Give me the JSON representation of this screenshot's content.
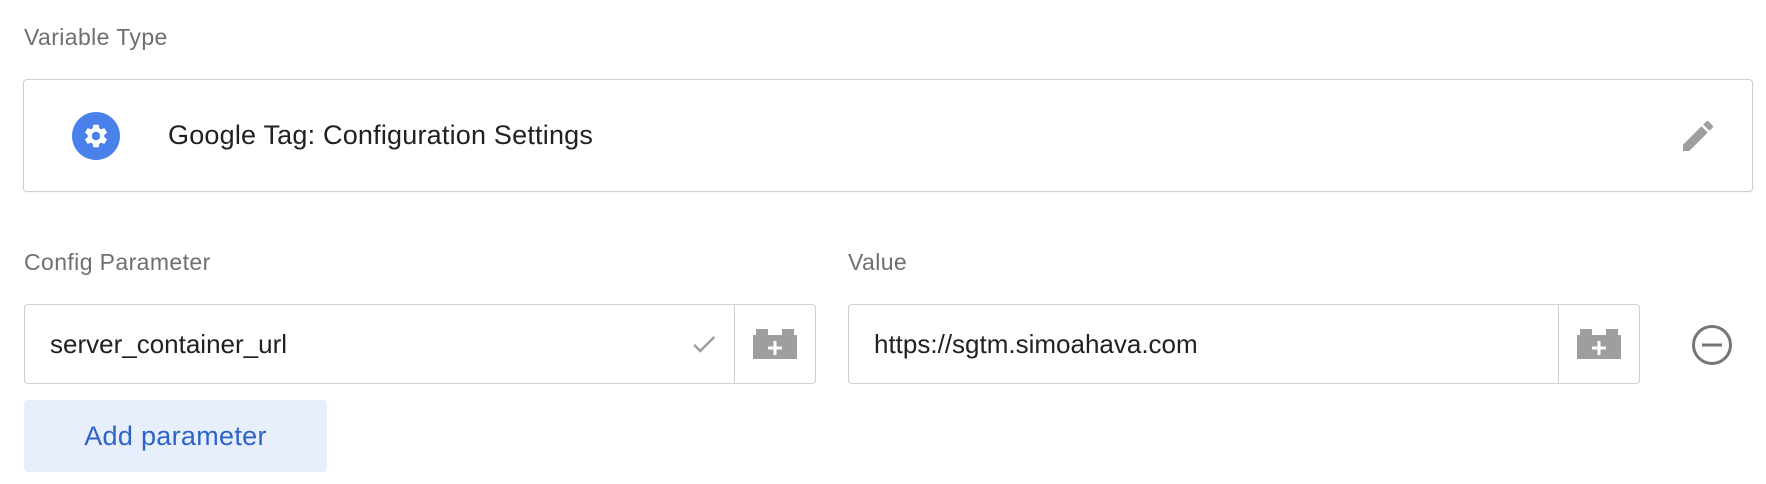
{
  "variable_type": {
    "section_label": "Variable Type",
    "title": "Google Tag: Configuration Settings",
    "icon": "gear-icon",
    "icon_color": "#4a80ea",
    "edit_icon": "pencil-icon"
  },
  "parameters": {
    "name_column_label": "Config Parameter",
    "value_column_label": "Value",
    "rows": [
      {
        "name": "server_container_url",
        "value": "https://sgtm.simoahava.com"
      }
    ]
  },
  "actions": {
    "add_parameter_label": "Add parameter"
  },
  "colors": {
    "accent": "#2d63c8",
    "accent_bg": "#e8effc",
    "border": "#cfcfcf",
    "label": "#6f6f6f",
    "icon_gray": "#9e9e9e"
  }
}
